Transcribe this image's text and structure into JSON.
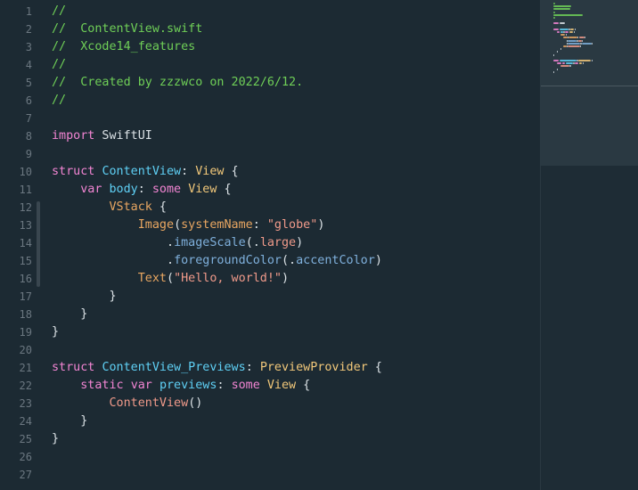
{
  "editor": {
    "colors": {
      "background": "#1c2a33",
      "comment": "#6fcf57",
      "keyword": "#f285d3",
      "type": "#f2c87a",
      "declaration": "#5fd0f5",
      "function": "#e8a661",
      "string": "#f09a8a",
      "member": "#7fb0dc",
      "plain": "#dbe2e6",
      "line_number": "#6b7780"
    },
    "line_numbers": [
      "1",
      "2",
      "3",
      "4",
      "5",
      "6",
      "7",
      "8",
      "9",
      "10",
      "11",
      "12",
      "13",
      "14",
      "15",
      "16",
      "17",
      "18",
      "19",
      "20",
      "21",
      "22",
      "23",
      "24",
      "25",
      "26",
      "27"
    ],
    "lines": [
      [
        {
          "t": "//",
          "c": "comment"
        }
      ],
      [
        {
          "t": "//  ContentView.swift",
          "c": "comment"
        }
      ],
      [
        {
          "t": "//  Xcode14_features",
          "c": "comment"
        }
      ],
      [
        {
          "t": "//",
          "c": "comment"
        }
      ],
      [
        {
          "t": "//  Created by zzzwco on 2022/6/12.",
          "c": "comment"
        }
      ],
      [
        {
          "t": "//",
          "c": "comment"
        }
      ],
      [],
      [
        {
          "t": "import",
          "c": "keyword"
        },
        {
          "t": " SwiftUI",
          "c": "plain"
        }
      ],
      [],
      [
        {
          "t": "struct",
          "c": "keyword"
        },
        {
          "t": " ",
          "c": "plain"
        },
        {
          "t": "ContentView",
          "c": "decl"
        },
        {
          "t": ": ",
          "c": "plain"
        },
        {
          "t": "View",
          "c": "type"
        },
        {
          "t": " {",
          "c": "plain"
        }
      ],
      [
        {
          "t": "    ",
          "c": "plain"
        },
        {
          "t": "var",
          "c": "keyword"
        },
        {
          "t": " ",
          "c": "plain"
        },
        {
          "t": "body",
          "c": "decl"
        },
        {
          "t": ": ",
          "c": "plain"
        },
        {
          "t": "some",
          "c": "keyword"
        },
        {
          "t": " ",
          "c": "plain"
        },
        {
          "t": "View",
          "c": "type"
        },
        {
          "t": " {",
          "c": "plain"
        }
      ],
      [
        {
          "t": "        ",
          "c": "plain"
        },
        {
          "t": "VStack",
          "c": "func"
        },
        {
          "t": " {",
          "c": "plain"
        }
      ],
      [
        {
          "t": "            ",
          "c": "plain"
        },
        {
          "t": "Image",
          "c": "func"
        },
        {
          "t": "(",
          "c": "plain"
        },
        {
          "t": "systemName",
          "c": "func"
        },
        {
          "t": ": ",
          "c": "plain"
        },
        {
          "t": "\"globe\"",
          "c": "string"
        },
        {
          "t": ")",
          "c": "plain"
        }
      ],
      [
        {
          "t": "                .",
          "c": "plain"
        },
        {
          "t": "imageScale",
          "c": "member"
        },
        {
          "t": "(.",
          "c": "plain"
        },
        {
          "t": "large",
          "c": "string"
        },
        {
          "t": ")",
          "c": "plain"
        }
      ],
      [
        {
          "t": "                .",
          "c": "plain"
        },
        {
          "t": "foregroundColor",
          "c": "member"
        },
        {
          "t": "(.",
          "c": "plain"
        },
        {
          "t": "accentColor",
          "c": "member"
        },
        {
          "t": ")",
          "c": "plain"
        }
      ],
      [
        {
          "t": "            ",
          "c": "plain"
        },
        {
          "t": "Text",
          "c": "func"
        },
        {
          "t": "(",
          "c": "plain"
        },
        {
          "t": "\"Hello, world!\"",
          "c": "string"
        },
        {
          "t": ")",
          "c": "plain"
        }
      ],
      [
        {
          "t": "        }",
          "c": "plain"
        }
      ],
      [
        {
          "t": "    }",
          "c": "plain"
        }
      ],
      [
        {
          "t": "}",
          "c": "plain"
        }
      ],
      [],
      [
        {
          "t": "struct",
          "c": "keyword"
        },
        {
          "t": " ",
          "c": "plain"
        },
        {
          "t": "ContentView_Previews",
          "c": "decl"
        },
        {
          "t": ": ",
          "c": "plain"
        },
        {
          "t": "PreviewProvider",
          "c": "type"
        },
        {
          "t": " {",
          "c": "plain"
        }
      ],
      [
        {
          "t": "    ",
          "c": "plain"
        },
        {
          "t": "static",
          "c": "keyword"
        },
        {
          "t": " ",
          "c": "plain"
        },
        {
          "t": "var",
          "c": "keyword"
        },
        {
          "t": " ",
          "c": "plain"
        },
        {
          "t": "previews",
          "c": "decl"
        },
        {
          "t": ": ",
          "c": "plain"
        },
        {
          "t": "some",
          "c": "keyword"
        },
        {
          "t": " ",
          "c": "plain"
        },
        {
          "t": "View",
          "c": "type"
        },
        {
          "t": " {",
          "c": "plain"
        }
      ],
      [
        {
          "t": "        ",
          "c": "plain"
        },
        {
          "t": "ContentView",
          "c": "string"
        },
        {
          "t": "()",
          "c": "plain"
        }
      ],
      [
        {
          "t": "    }",
          "c": "plain"
        }
      ],
      [
        {
          "t": "}",
          "c": "plain"
        }
      ],
      [],
      []
    ]
  }
}
